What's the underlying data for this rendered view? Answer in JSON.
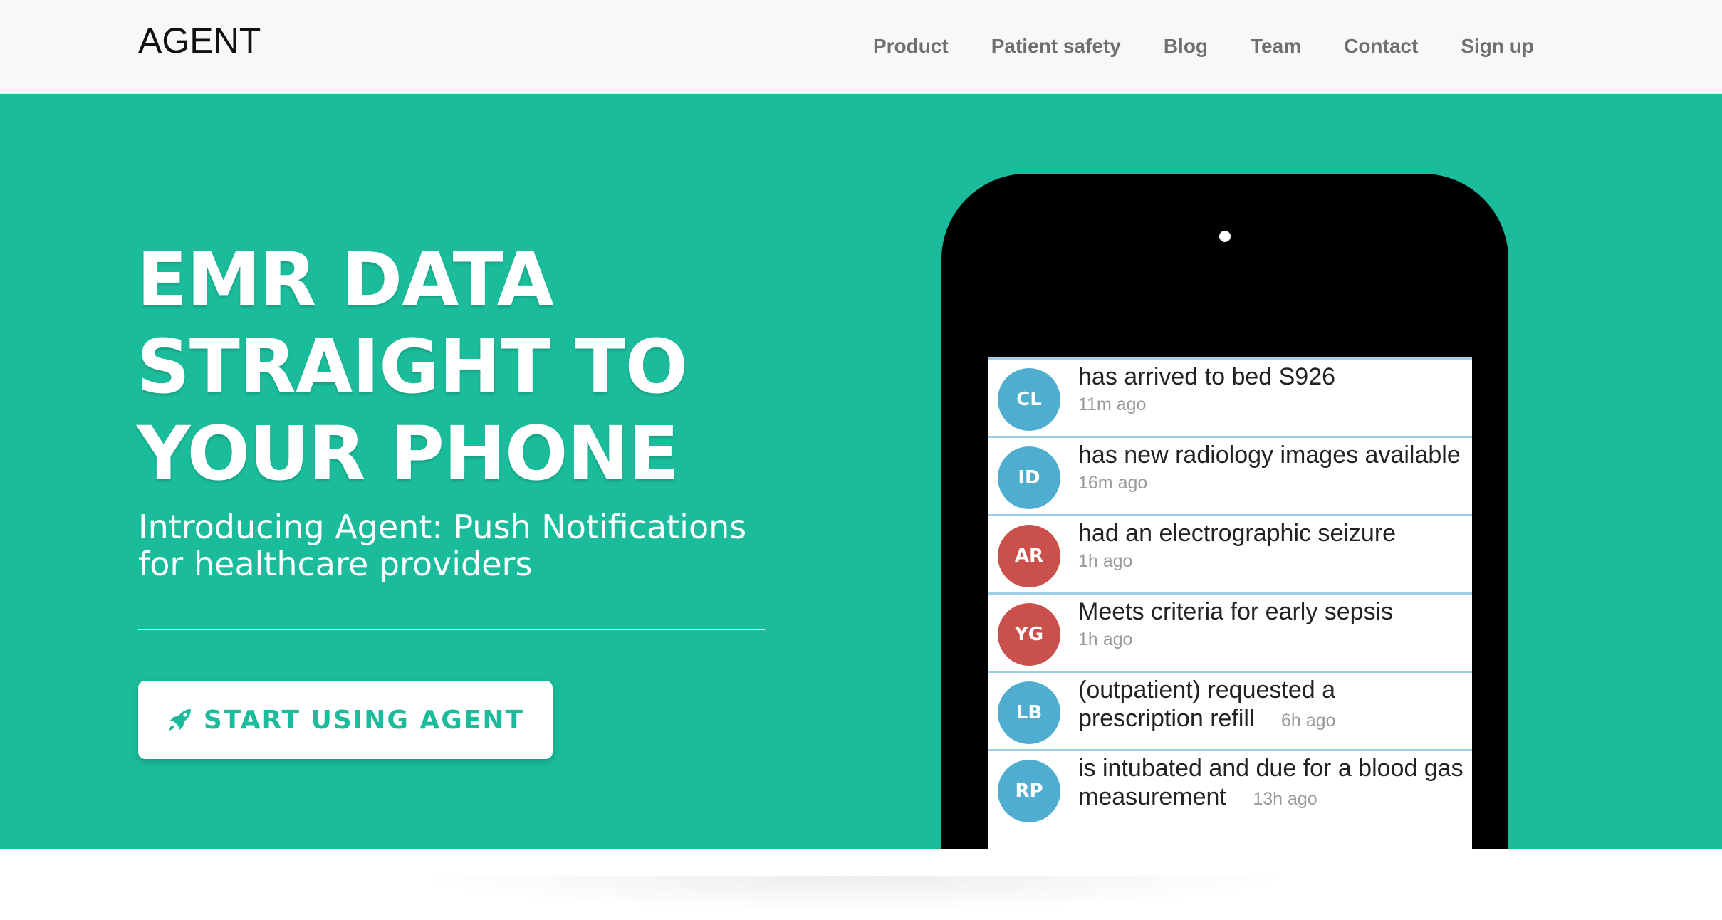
{
  "navbar": {
    "brand": "AGENT",
    "links": [
      {
        "label": "Product"
      },
      {
        "label": "Patient safety"
      },
      {
        "label": "Blog"
      },
      {
        "label": "Team"
      },
      {
        "label": "Contact"
      },
      {
        "label": "Sign up"
      }
    ]
  },
  "hero": {
    "title_lines": [
      "EMR DATA",
      "STRAIGHT TO",
      "YOUR PHONE"
    ],
    "subtitle_line1": "Introducing Agent: Push Notifications",
    "subtitle_line2": "for healthcare providers",
    "cta_label": "START USING AGENT",
    "cta_icon": "rocket-icon",
    "accent_color": "#1bbc9b"
  },
  "phone": {
    "notifications": [
      {
        "initials": "CL",
        "message": "has arrived to bed S926",
        "time": "11m ago",
        "avatar_color": "#4fadcf"
      },
      {
        "initials": "ID",
        "message": "has new radiology images available",
        "time": "16m ago",
        "avatar_color": "#4fadcf"
      },
      {
        "initials": "AR",
        "message": "had an electrographic seizure",
        "time": "1h ago",
        "avatar_color": "#c9504b"
      },
      {
        "initials": "YG",
        "message": "Meets criteria for early sepsis",
        "time": "1h ago",
        "avatar_color": "#c9504b"
      },
      {
        "initials": "LB",
        "message": "(outpatient) requested a prescription refill",
        "time": "6h ago",
        "avatar_color": "#4fadcf"
      },
      {
        "initials": "RP",
        "message": "is intubated and due for a blood gas measurement",
        "time": "13h ago",
        "avatar_color": "#4fadcf"
      }
    ]
  }
}
